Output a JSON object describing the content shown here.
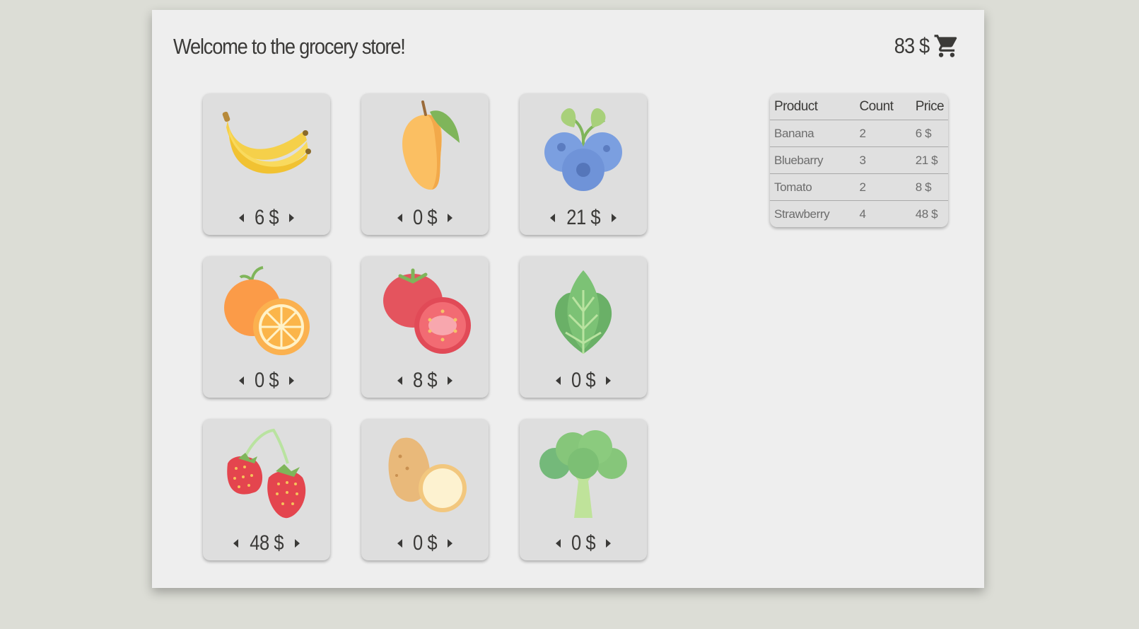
{
  "header": {
    "title": "Welcome to the grocery store!",
    "cart_total": "83 $",
    "cart_icon": "shopping-cart-icon"
  },
  "products": [
    {
      "name": "banana",
      "price": "6 $",
      "icon": "banana-icon"
    },
    {
      "name": "mango",
      "price": "0 $",
      "icon": "mango-icon"
    },
    {
      "name": "blueberry",
      "price": "21 $",
      "icon": "blueberry-icon"
    },
    {
      "name": "orange",
      "price": "0 $",
      "icon": "orange-icon"
    },
    {
      "name": "tomato",
      "price": "8 $",
      "icon": "tomato-icon"
    },
    {
      "name": "spinach",
      "price": "0 $",
      "icon": "spinach-icon"
    },
    {
      "name": "strawberry",
      "price": "48 $",
      "icon": "strawberry-icon"
    },
    {
      "name": "potato",
      "price": "0 $",
      "icon": "potato-icon"
    },
    {
      "name": "broccoli",
      "price": "0 $",
      "icon": "broccoli-icon"
    }
  ],
  "summary_table": {
    "headers": [
      "Product",
      "Count",
      "Price"
    ],
    "rows": [
      [
        "Banana",
        "2",
        "6 $"
      ],
      [
        "Bluebarry",
        "3",
        "21 $"
      ],
      [
        "Tomato",
        "2",
        "8 $"
      ],
      [
        "Strawberry",
        "4",
        "48 $"
      ]
    ]
  },
  "colors": {
    "background": "#dcddd6",
    "panel": "#eeeeee",
    "card": "#dedede",
    "text": "#3b3a38"
  }
}
